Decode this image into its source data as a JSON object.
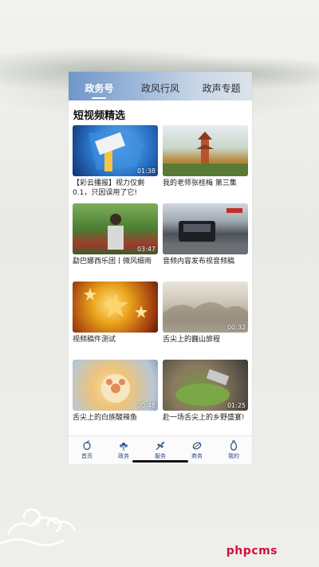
{
  "tabs": [
    {
      "label": "政务号",
      "active": true
    },
    {
      "label": "政风行风",
      "active": false
    },
    {
      "label": "政声专题",
      "active": false
    }
  ],
  "section": {
    "title": "短视频精选"
  },
  "videos": [
    {
      "title": "【彩云播报】视力仅剩0.1，只因误用了它!",
      "duration": "01:38"
    },
    {
      "title": "我的老师张桂梅 第三集",
      "duration": ""
    },
    {
      "title": "勐巴娜西乐团丨微风细雨",
      "duration": "03:47"
    },
    {
      "title": "音频内容发布视音频稿",
      "duration": ""
    },
    {
      "title": "视频稿件测试",
      "duration": ""
    },
    {
      "title": "舌尖上的巍山旅程",
      "duration": "00:32"
    },
    {
      "title": "舌尖上的白族酸辣鱼",
      "duration": "00:48"
    },
    {
      "title": "赴一场舌尖上的乡野盛宴!",
      "duration": "01:25"
    }
  ],
  "nav": [
    {
      "label": "首页",
      "icon": "peach-icon"
    },
    {
      "label": "政务",
      "icon": "flower-icon"
    },
    {
      "label": "服务",
      "icon": "branch-icon"
    },
    {
      "label": "商务",
      "icon": "leaf-icon"
    },
    {
      "label": "我的",
      "icon": "vase-icon"
    }
  ],
  "watermark": "phpcms",
  "colors": {
    "accent": "#2b4a7a",
    "tab_gradient_start": "#6f97c8",
    "watermark": "#d0103a"
  }
}
